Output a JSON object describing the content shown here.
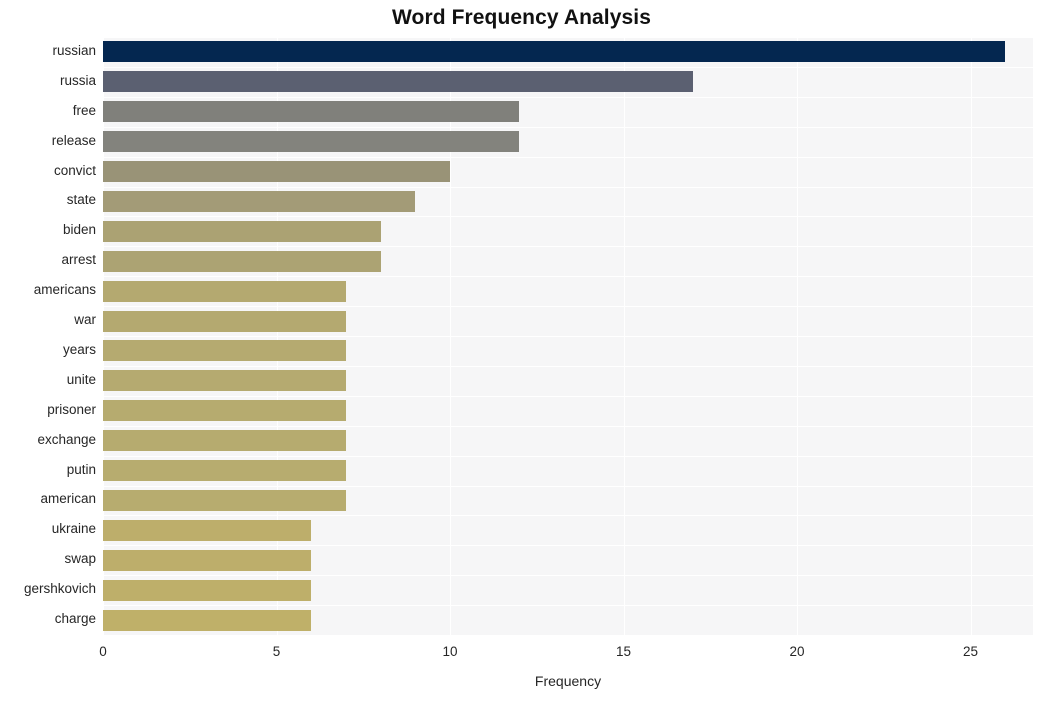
{
  "chart_data": {
    "type": "bar",
    "orientation": "horizontal",
    "title": "Word Frequency Analysis",
    "xlabel": "Frequency",
    "ylabel": "",
    "xlim": [
      0,
      26.8
    ],
    "ylim": null,
    "grid": true,
    "legend": false,
    "legend_position": "none",
    "xticks": [
      "0",
      "5",
      "10",
      "15",
      "20",
      "25"
    ],
    "xtick_values": [
      0,
      5,
      10,
      15,
      20,
      25
    ],
    "categories": [
      "russian",
      "russia",
      "free",
      "release",
      "convict",
      "state",
      "biden",
      "arrest",
      "americans",
      "war",
      "years",
      "unite",
      "prisoner",
      "exchange",
      "putin",
      "american",
      "ukraine",
      "swap",
      "gershkovich",
      "charge"
    ],
    "values": [
      26,
      17,
      12,
      12,
      10,
      9,
      8,
      8,
      7,
      7,
      7,
      7,
      7,
      7,
      7,
      7,
      6,
      6,
      6,
      6
    ],
    "bar_colors": [
      "#042750",
      "#5b6071",
      "#80807b",
      "#83837d",
      "#999377",
      "#a39b77",
      "#aba273",
      "#aca373",
      "#b4a970",
      "#b4a970",
      "#b5aa70",
      "#b5aa70",
      "#b6ab6f",
      "#b6ab6f",
      "#b7ac6f",
      "#b7ac6f",
      "#bdae6b",
      "#bdae6b",
      "#beaf6a",
      "#bfb069"
    ],
    "plot_background": "#f6f6f7",
    "grid_color": "#ffffff",
    "figure_background": "#ffffff",
    "text_color": "#262626"
  }
}
